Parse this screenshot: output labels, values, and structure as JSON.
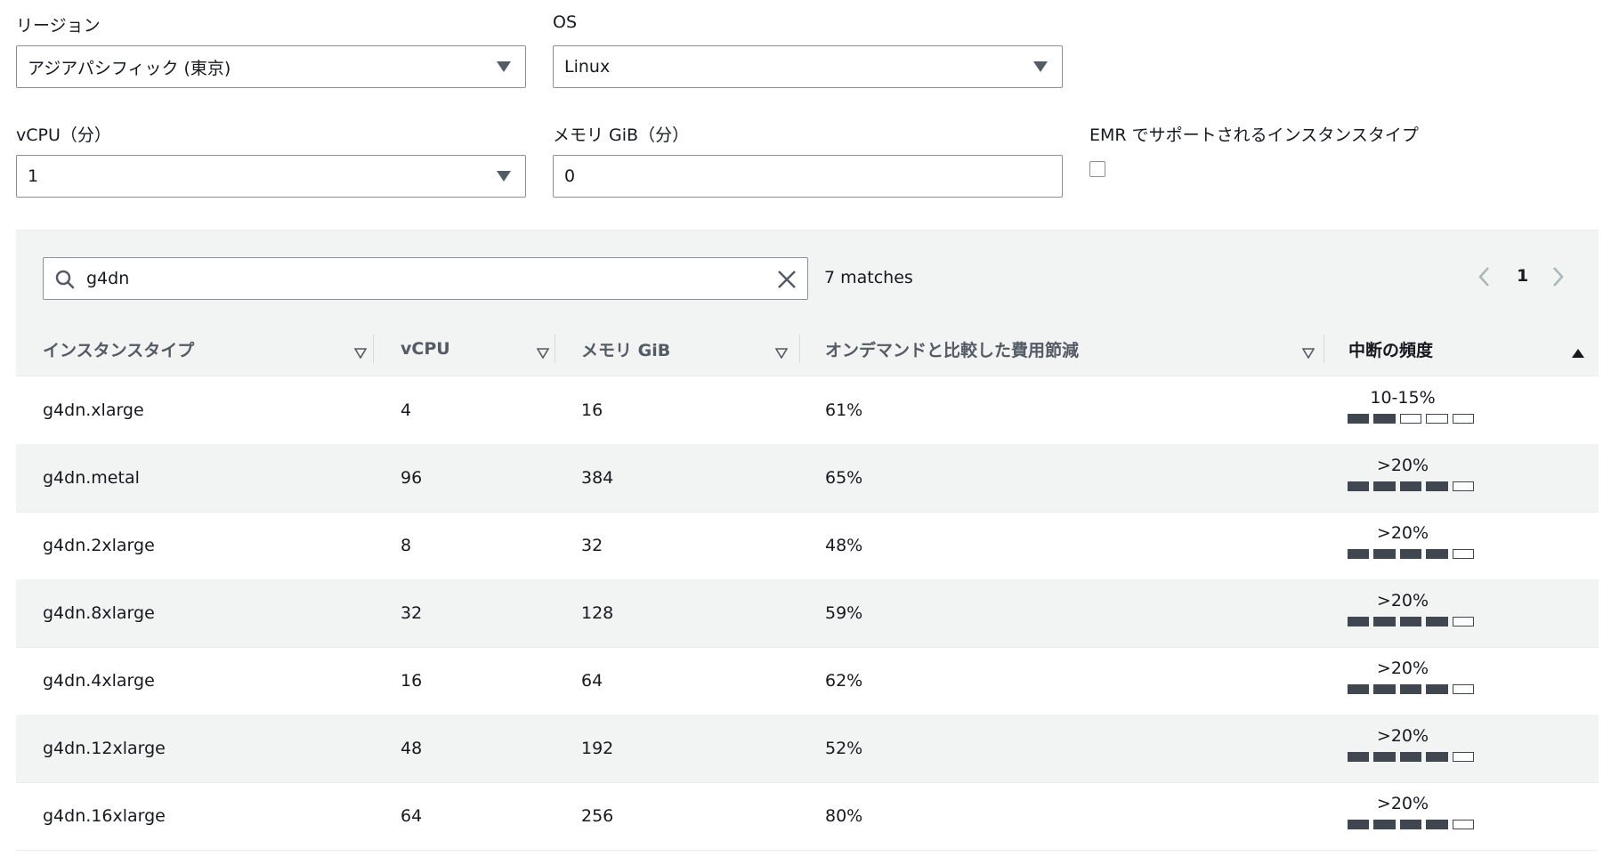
{
  "filters": {
    "region": {
      "label": "リージョン",
      "value": "アジアパシフィック (東京)"
    },
    "os": {
      "label": "OS",
      "value": "Linux"
    },
    "vcpu": {
      "label": "vCPU（分）",
      "value": "1"
    },
    "memory": {
      "label": "メモリ GiB（分）",
      "value": "0"
    },
    "emr": {
      "label": "EMR でサポートされるインスタンスタイプ",
      "checked": false
    }
  },
  "search": {
    "value": "g4dn",
    "matches": "7 matches"
  },
  "pagination": {
    "current": "1"
  },
  "columns": [
    "インスタンスタイプ",
    "vCPU",
    "メモリ GiB",
    "オンデマンドと比較した費用節減",
    "中断の頻度"
  ],
  "rows": [
    {
      "type": "g4dn.xlarge",
      "vcpu": "4",
      "memory": "16",
      "savings": "61%",
      "interrupt": "10-15%",
      "level": 2
    },
    {
      "type": "g4dn.metal",
      "vcpu": "96",
      "memory": "384",
      "savings": "65%",
      "interrupt": ">20%",
      "level": 4
    },
    {
      "type": "g4dn.2xlarge",
      "vcpu": "8",
      "memory": "32",
      "savings": "48%",
      "interrupt": ">20%",
      "level": 4
    },
    {
      "type": "g4dn.8xlarge",
      "vcpu": "32",
      "memory": "128",
      "savings": "59%",
      "interrupt": ">20%",
      "level": 4
    },
    {
      "type": "g4dn.4xlarge",
      "vcpu": "16",
      "memory": "64",
      "savings": "62%",
      "interrupt": ">20%",
      "level": 4
    },
    {
      "type": "g4dn.12xlarge",
      "vcpu": "48",
      "memory": "192",
      "savings": "52%",
      "interrupt": ">20%",
      "level": 4
    },
    {
      "type": "g4dn.16xlarge",
      "vcpu": "64",
      "memory": "256",
      "savings": "80%",
      "interrupt": ">20%",
      "level": 4
    }
  ],
  "icons": {
    "search": "search-icon",
    "clear": "close-icon",
    "prev": "chevron-left-icon",
    "next": "chevron-right-icon",
    "sort": "caret-down-icon",
    "sort_active": "caret-up-icon",
    "dropdown": "caret-down-icon"
  }
}
